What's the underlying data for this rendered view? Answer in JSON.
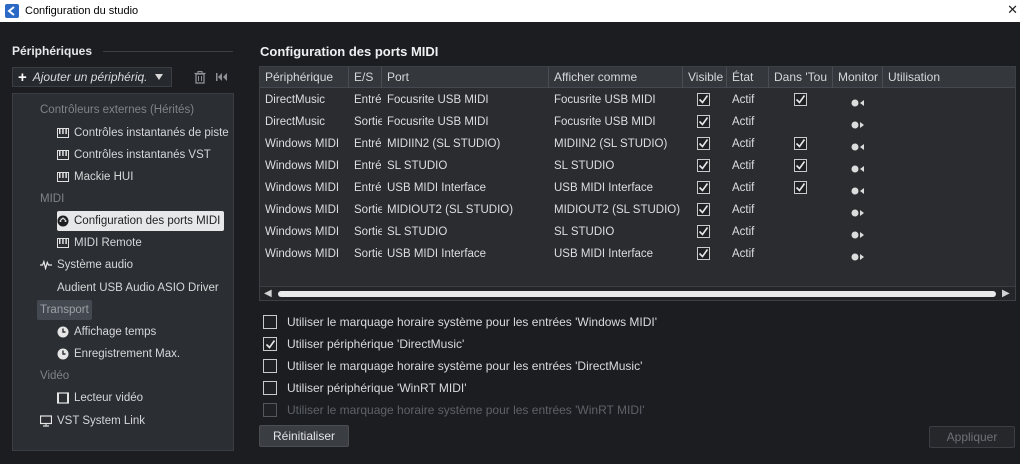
{
  "window": {
    "title": "Configuration du studio",
    "close": "✕"
  },
  "left": {
    "header": "Périphériques",
    "add_device": "Ajouter un périphériq.",
    "tree": [
      {
        "label": "Contrôleurs externes (Hérités)",
        "kind": "category"
      },
      {
        "label": "Contrôles instantanés de piste",
        "kind": "item",
        "icon": "midi-keyboard-icon"
      },
      {
        "label": "Contrôles instantanés VST",
        "kind": "item",
        "icon": "midi-keyboard-icon"
      },
      {
        "label": "Mackie HUI",
        "kind": "item",
        "icon": "midi-keyboard-icon"
      },
      {
        "label": "MIDI",
        "kind": "category"
      },
      {
        "label": "Configuration des ports MIDI",
        "kind": "selected",
        "icon": "midi-port-icon"
      },
      {
        "label": "MIDI Remote",
        "kind": "item",
        "icon": "midi-keyboard-icon"
      },
      {
        "label": "Système audio",
        "kind": "item",
        "icon": "audio-wave-icon"
      },
      {
        "label": "Audient USB Audio ASIO Driver",
        "kind": "item"
      },
      {
        "label": "Transport",
        "kind": "category-selected"
      },
      {
        "label": "Affichage temps",
        "kind": "item",
        "icon": "clock-icon"
      },
      {
        "label": "Enregistrement Max.",
        "kind": "item",
        "icon": "clock-icon"
      },
      {
        "label": "Vidéo",
        "kind": "category"
      },
      {
        "label": "Lecteur vidéo",
        "kind": "item",
        "icon": "video-frame-icon"
      },
      {
        "label": "VST System Link",
        "kind": "item",
        "icon": "monitor-icon"
      }
    ]
  },
  "main": {
    "title": "Configuration des ports MIDI",
    "columns": [
      "Périphérique",
      "E/S",
      "Port",
      "Afficher comme",
      "Visible",
      "État",
      "Dans 'Tou",
      "Monitor",
      "Utilisation"
    ],
    "rows": [
      {
        "device": "DirectMusic",
        "io": "Entré",
        "port": "Focusrite USB MIDI",
        "display": "Focusrite USB MIDI",
        "visible": true,
        "state": "Actif",
        "in_all": true,
        "monitor": "input"
      },
      {
        "device": "DirectMusic",
        "io": "Sortie",
        "port": "Focusrite USB MIDI",
        "display": "Focusrite USB MIDI",
        "visible": true,
        "state": "Actif",
        "in_all": false,
        "monitor": "output"
      },
      {
        "device": "Windows MIDI",
        "io": "Entré",
        "port": "MIDIIN2 (SL STUDIO)",
        "display": "MIDIIN2 (SL STUDIO)",
        "visible": true,
        "state": "Actif",
        "in_all": true,
        "monitor": "input"
      },
      {
        "device": "Windows MIDI",
        "io": "Entré",
        "port": "SL STUDIO",
        "display": "SL STUDIO",
        "visible": true,
        "state": "Actif",
        "in_all": true,
        "monitor": "input"
      },
      {
        "device": "Windows MIDI",
        "io": "Entré",
        "port": "USB MIDI Interface",
        "display": "USB MIDI Interface",
        "visible": true,
        "state": "Actif",
        "in_all": true,
        "monitor": "input"
      },
      {
        "device": "Windows MIDI",
        "io": "Sortie",
        "port": "MIDIOUT2 (SL STUDIO)",
        "display": "MIDIOUT2 (SL STUDIO)",
        "visible": true,
        "state": "Actif",
        "in_all": false,
        "monitor": "output"
      },
      {
        "device": "Windows MIDI",
        "io": "Sortie",
        "port": "SL STUDIO",
        "display": "SL STUDIO",
        "visible": true,
        "state": "Actif",
        "in_all": false,
        "monitor": "output"
      },
      {
        "device": "Windows MIDI",
        "io": "Sortie",
        "port": "USB MIDI Interface",
        "display": "USB MIDI Interface",
        "visible": true,
        "state": "Actif",
        "in_all": false,
        "monitor": "output"
      }
    ],
    "options": [
      {
        "label": "Utiliser le marquage horaire système pour les entrées 'Windows MIDI'",
        "checked": false,
        "disabled": false
      },
      {
        "label": "Utiliser périphérique 'DirectMusic'",
        "checked": true,
        "disabled": false
      },
      {
        "label": "Utiliser le marquage horaire système pour les entrées 'DirectMusic'",
        "checked": false,
        "disabled": false
      },
      {
        "label": "Utiliser périphérique 'WinRT MIDI'",
        "checked": false,
        "disabled": false
      },
      {
        "label": "Utiliser le marquage horaire système pour les entrées 'WinRT MIDI'",
        "checked": false,
        "disabled": true
      }
    ],
    "reset_label": "Réinitialiser",
    "apply_label": "Appliquer"
  }
}
